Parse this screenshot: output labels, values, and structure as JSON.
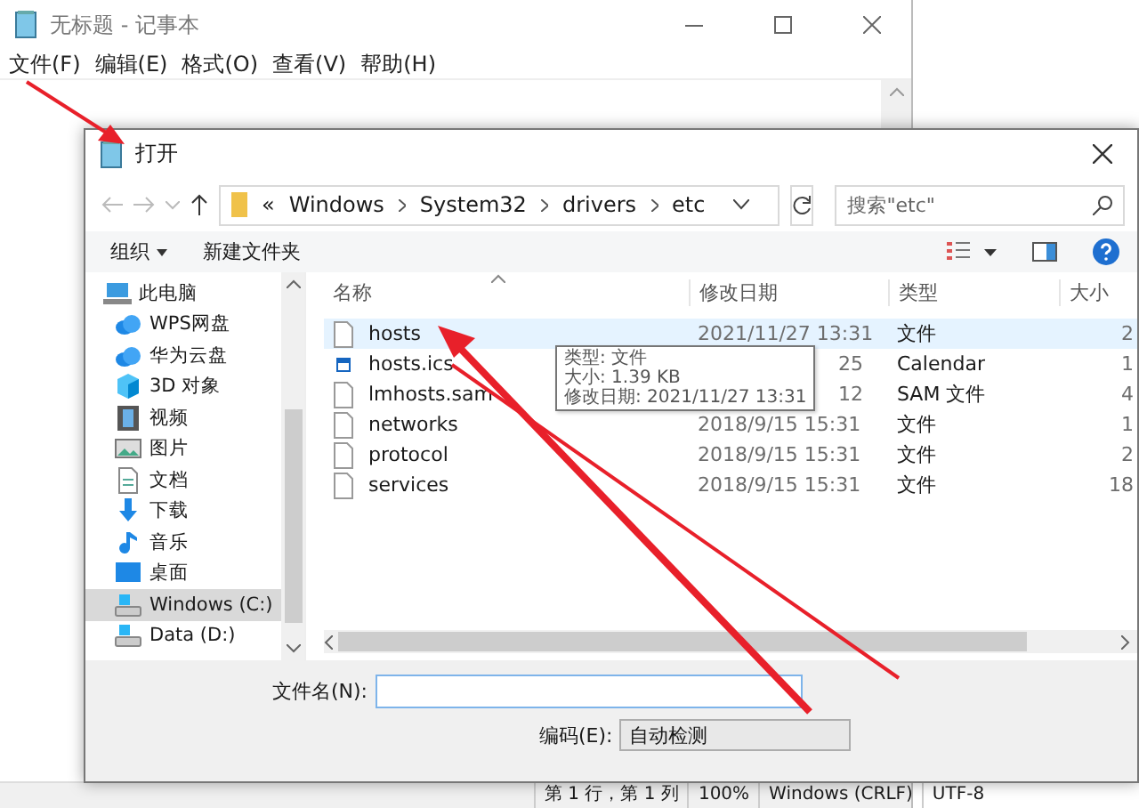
{
  "notepad": {
    "title": "无标题 - 记事本",
    "menu": [
      "文件(F)",
      "编辑(E)",
      "格式(O)",
      "查看(V)",
      "帮助(H)"
    ],
    "status_bar": [
      "第 1 行，第 1 列",
      "100%",
      "Windows (CRLF)",
      "UTF-8"
    ]
  },
  "dialog": {
    "title": "打开",
    "address": {
      "overflow": "«",
      "segments": [
        "Windows",
        "System32",
        "drivers",
        "etc"
      ]
    },
    "search": {
      "placeholder": "搜索\"etc\""
    },
    "toolbar": {
      "organize": "组织",
      "new_folder": "新建文件夹"
    },
    "nav_pane": [
      {
        "label": "此电脑",
        "kind": "pc",
        "selected": false
      },
      {
        "label": "WPS网盘",
        "kind": "cloud",
        "selected": false
      },
      {
        "label": "华为云盘",
        "kind": "cloud",
        "selected": false
      },
      {
        "label": "3D 对象",
        "kind": "cube",
        "selected": false
      },
      {
        "label": "视频",
        "kind": "video",
        "selected": false
      },
      {
        "label": "图片",
        "kind": "picture",
        "selected": false
      },
      {
        "label": "文档",
        "kind": "document",
        "selected": false
      },
      {
        "label": "下载",
        "kind": "download",
        "selected": false
      },
      {
        "label": "音乐",
        "kind": "music",
        "selected": false
      },
      {
        "label": "桌面",
        "kind": "desktop",
        "selected": false
      },
      {
        "label": "Windows (C:)",
        "kind": "drive",
        "selected": true
      },
      {
        "label": "Data (D:)",
        "kind": "drive",
        "selected": false
      }
    ],
    "columns": [
      "名称",
      "修改日期",
      "类型",
      "大小"
    ],
    "files": [
      {
        "name": "hosts",
        "kind": "file",
        "date": "2021/11/27 13:31",
        "date_covered": false,
        "type": "文件",
        "size": "2",
        "selected": true
      },
      {
        "name": "hosts.ics",
        "kind": "calendar",
        "date": "25",
        "date_covered": true,
        "type": "Calendar",
        "size": "1",
        "selected": false
      },
      {
        "name": "lmhosts.sam",
        "kind": "file",
        "date": "12",
        "date_covered": true,
        "type": "SAM 文件",
        "size": "4",
        "selected": false
      },
      {
        "name": "networks",
        "kind": "file",
        "date": "2018/9/15 15:31",
        "date_covered": false,
        "type": "文件",
        "size": "1",
        "selected": false
      },
      {
        "name": "protocol",
        "kind": "file",
        "date": "2018/9/15 15:31",
        "date_covered": false,
        "type": "文件",
        "size": "2",
        "selected": false
      },
      {
        "name": "services",
        "kind": "file",
        "date": "2018/9/15 15:31",
        "date_covered": false,
        "type": "文件",
        "size": "18",
        "selected": false
      }
    ],
    "tooltip": [
      "类型: 文件",
      "大小: 1.39 KB",
      "修改日期: 2021/11/27 13:31"
    ],
    "filename": {
      "label": "文件名(N):"
    },
    "encoding": {
      "label": "编码(E):",
      "value": "自动检测"
    }
  }
}
